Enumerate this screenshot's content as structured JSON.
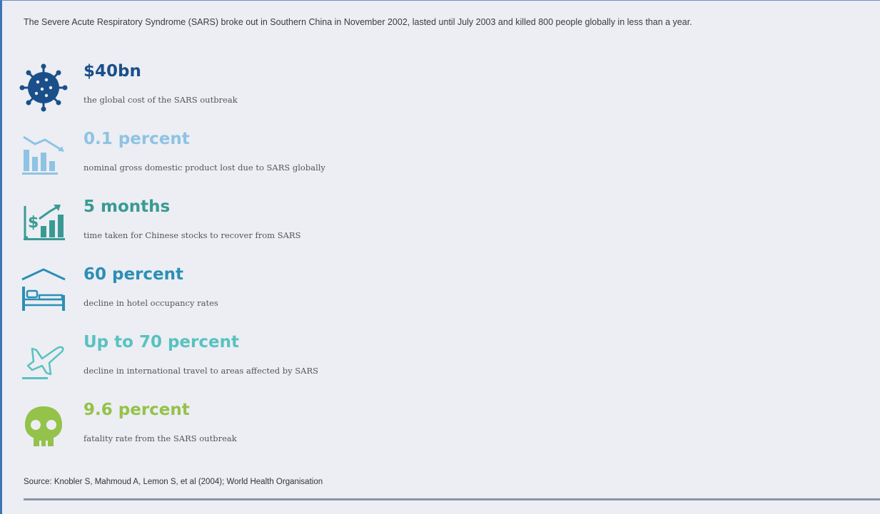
{
  "intro": "The Severe Acute Respiratory Syndrome (SARS) broke out in Southern China in November 2002, lasted until July 2003 and killed 800 people globally in less than a year.",
  "stats": [
    {
      "value": "$40bn",
      "description": "the global cost of the SARS outbreak",
      "color": "#1b4f8a",
      "icon": "virus-icon"
    },
    {
      "value": "0.1 percent",
      "description": "nominal gross domestic product lost due to SARS globally",
      "color": "#8ec3e3",
      "icon": "declining-bar-chart-icon"
    },
    {
      "value": "5 months",
      "description": "time taken for Chinese stocks to recover from SARS",
      "color": "#3a9a93",
      "icon": "stock-growth-icon"
    },
    {
      "value": "60 percent",
      "description": "decline in hotel occupancy rates",
      "color": "#2c8fb5",
      "icon": "hotel-bed-icon"
    },
    {
      "value": "Up to 70 percent",
      "description": "decline in international travel to areas affected by SARS",
      "color": "#58c2c0",
      "icon": "airplane-icon"
    },
    {
      "value": "9.6 percent",
      "description": "fatality rate from the SARS outbreak",
      "color": "#94c24a",
      "icon": "skull-icon"
    }
  ],
  "source": "Source: Knobler S, Mahmoud A, Lemon S, et al (2004); World Health Organisation"
}
